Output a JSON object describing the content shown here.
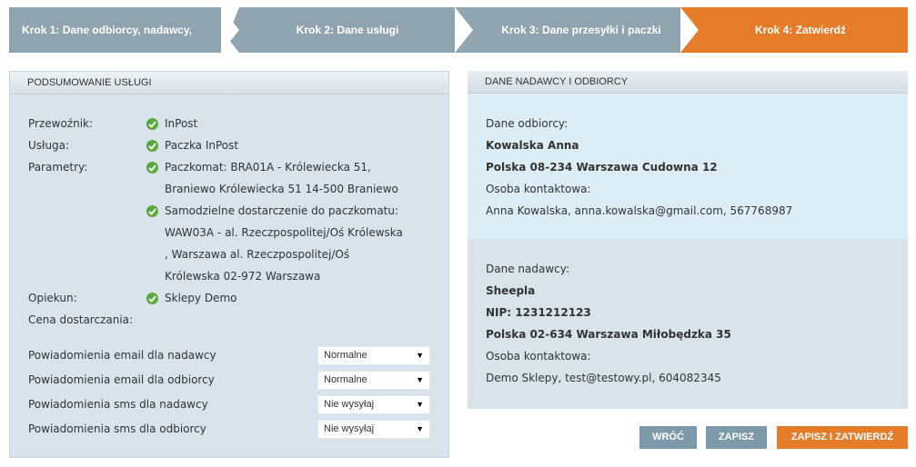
{
  "steps": [
    {
      "label": "Krok 1: Dane odbiorcy, nadawcy,",
      "state": "done"
    },
    {
      "label": "Krok 2: Dane usługi",
      "state": "done"
    },
    {
      "label": "Krok 3: Dane przesyłki i paczki",
      "state": "done"
    },
    {
      "label": "Krok 4: Zatwierdź",
      "state": "active"
    }
  ],
  "colors": {
    "step_grey": "#90a4af",
    "step_active": "#e57c2a",
    "check": "#5aa83c"
  },
  "summary": {
    "title": "PODSUMOWANIE USŁUGI",
    "carrier_label": "Przewoźnik:",
    "carrier_value": "InPost",
    "service_label": "Usługa:",
    "service_value": "Paczka InPost",
    "params_label": "Parametry:",
    "param1_line1": "Paczkomat: BRA01A - Królewiecka 51,",
    "param1_line2": "Braniewo Królewiecka 51 14-500 Braniewo",
    "param2_line1": "Samodzielne dostarczenie do paczkomatu:",
    "param2_line2": "WAW03A - al. Rzeczpospolitej/Oś Królewska",
    "param2_line3": ", Warszawa al. Rzeczpospolitej/Oś",
    "param2_line4": "Królewska 02-972 Warszawa",
    "guardian_label": "Opiekun:",
    "guardian_value": "Sklepy Demo",
    "price_label": "Cena dostarczania:"
  },
  "notifications": [
    {
      "label": "Powiadomienia email dla nadawcy",
      "value": "Normalne"
    },
    {
      "label": "Powiadomienia email dla odbiorcy",
      "value": "Normalne"
    },
    {
      "label": "Powiadomienia sms dla nadawcy",
      "value": "Nie wysyłaj"
    },
    {
      "label": "Powiadomienia sms dla odbiorcy",
      "value": "Nie wysyłaj"
    }
  ],
  "parties": {
    "title": "DANE NADAWCY I ODBIORCY",
    "recipient": {
      "heading": "Dane odbiorcy:",
      "name": "Kowalska Anna",
      "address": "Polska 08-234 Warszawa Cudowna 12",
      "contact_label": "Osoba kontaktowa:",
      "contact": "Anna Kowalska, anna.kowalska@gmail.com, 567768987"
    },
    "sender": {
      "heading": "Dane nadawcy:",
      "name": "Sheepla",
      "nip": "NIP: 1231212123",
      "address": "Polska 02-634 Warszawa Miłobędzka 35",
      "contact_label": "Osoba kontaktowa:",
      "contact": "Demo Sklepy, test@testowy.pl, 604082345"
    }
  },
  "buttons": {
    "back": "WRÓĆ",
    "save": "ZAPISZ",
    "save_confirm": "ZAPISZ I ZATWIERDŹ"
  }
}
